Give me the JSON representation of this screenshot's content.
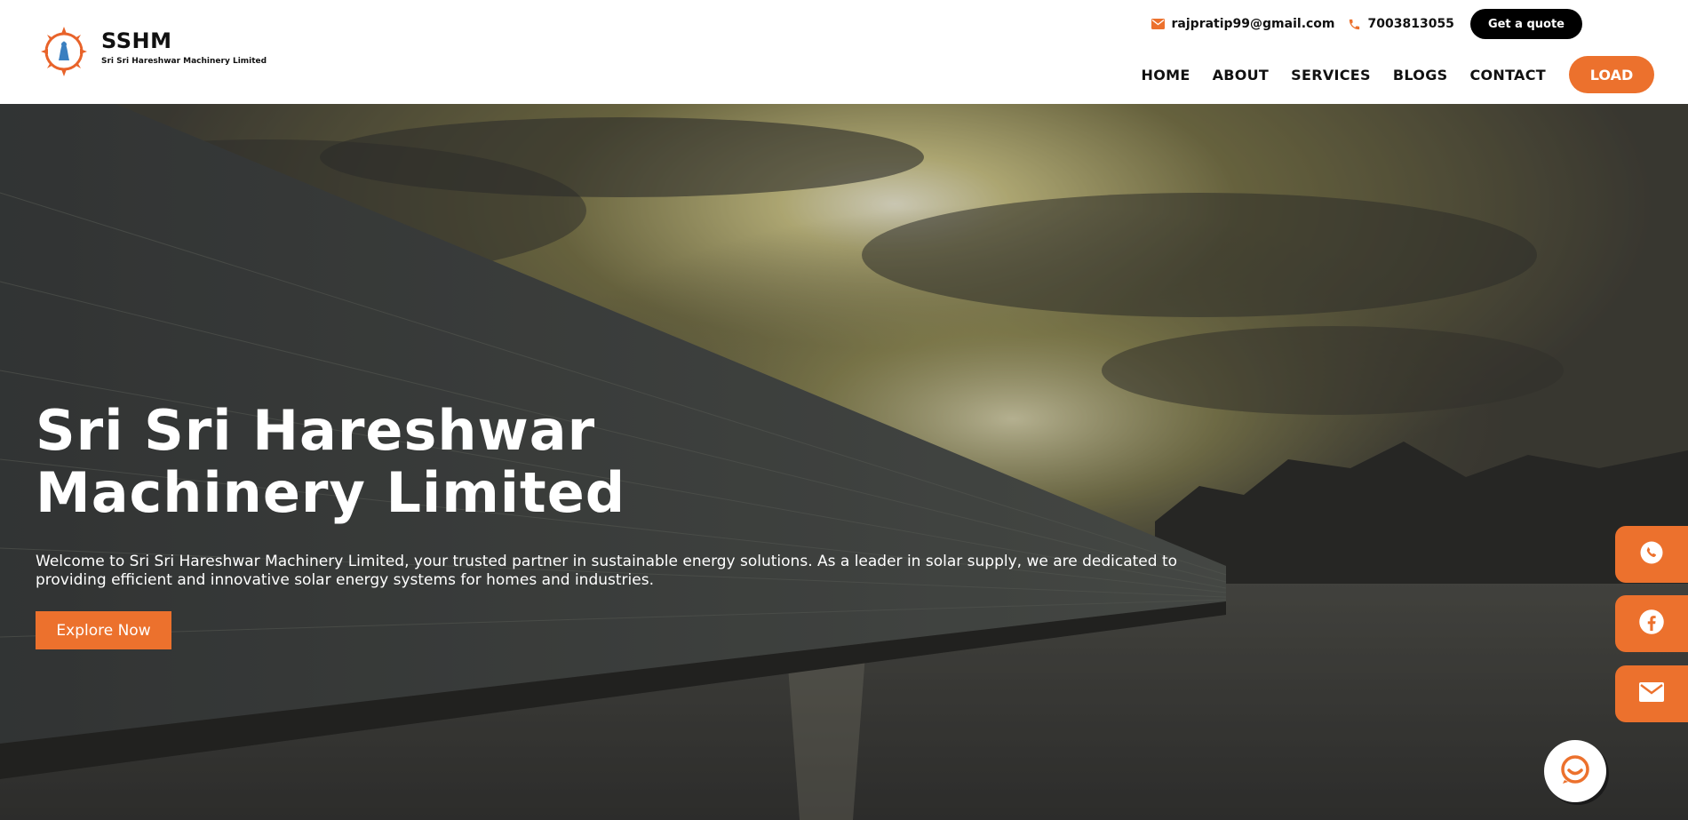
{
  "brand": {
    "title": "SSHM",
    "subtitle": "Sri Sri Hareshwar Machinery Limited"
  },
  "contact": {
    "email": "rajpratip99@gmail.com",
    "phone": "7003813055",
    "quote_label": "Get a quote"
  },
  "nav": {
    "items": [
      {
        "label": "HOME"
      },
      {
        "label": "ABOUT"
      },
      {
        "label": "SERVICES"
      },
      {
        "label": "BLOGS"
      },
      {
        "label": "CONTACT"
      }
    ],
    "load_label": "LOAD"
  },
  "hero": {
    "title": "Sri Sri Hareshwar Machinery Limited",
    "description": "Welcome to Sri Sri Hareshwar Machinery Limited, your trusted partner in sustainable energy solutions. As a leader in solar supply, we are dedicated to providing efficient and innovative solar energy systems for homes and industries.",
    "button_label": "Explore Now"
  },
  "icons": {
    "email": "mail-icon",
    "phone": "phone-icon",
    "whatsapp": "whatsapp-icon",
    "facebook": "facebook-icon",
    "mail": "mail-icon",
    "chat": "chat-icon"
  },
  "colors": {
    "accent": "#ec712d",
    "dark": "#000000",
    "text": "#111111"
  }
}
